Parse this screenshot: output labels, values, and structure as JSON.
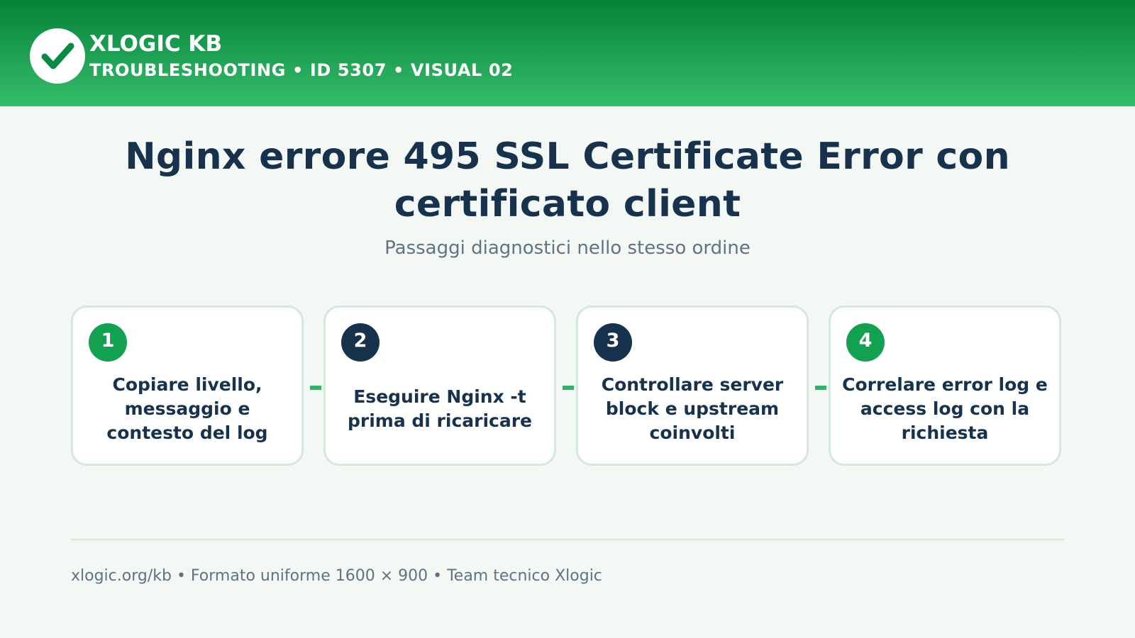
{
  "header": {
    "brand": "XLOGIC KB",
    "kicker": "TROUBLESHOOTING • ID 5307 • VISUAL 02",
    "logo_icon": "check-icon"
  },
  "main": {
    "title": "Nginx errore 495 SSL Certificate Error con certificato client",
    "subtitle": "Passaggi diagnostici nello stesso ordine"
  },
  "steps": [
    {
      "number": "1",
      "text": "Copiare livello, messaggio e contesto del log",
      "badge_color": "#12a150"
    },
    {
      "number": "2",
      "text": "Eseguire Nginx -t prima di ricaricare",
      "badge_color": "#17324d"
    },
    {
      "number": "3",
      "text": "Controllare server block e upstream coinvolti",
      "badge_color": "#17324d"
    },
    {
      "number": "4",
      "text": "Correlare error log e access log con la richiesta",
      "badge_color": "#12a150"
    }
  ],
  "footer": {
    "text": "xlogic.org/kb • Formato uniforme 1600 × 900 • Team tecnico Xlogic"
  },
  "colors": {
    "header_top": "#058239",
    "header_bottom": "#35bd6b",
    "accent": "#2fb463",
    "navy": "#17324d",
    "background": "#f3f8f5"
  }
}
